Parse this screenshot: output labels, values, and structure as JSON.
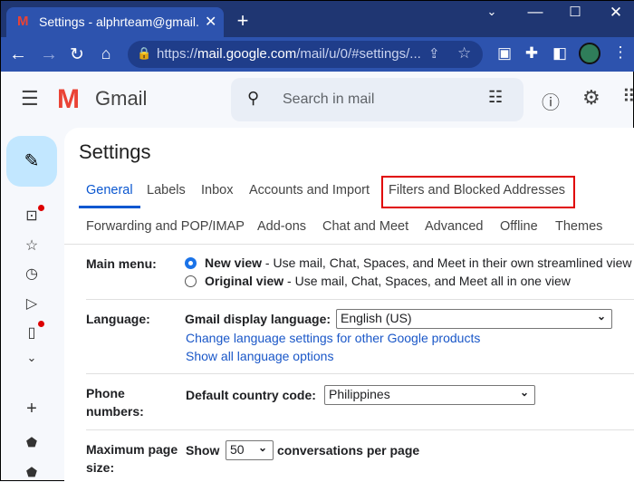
{
  "browser": {
    "tab_title": "Settings - alphrteam@gmail.com",
    "url_prefix": "https://",
    "url_host": "mail.google.com",
    "url_path": "/mail/u/0/#settings/..."
  },
  "app": {
    "name": "Gmail",
    "search_placeholder": "Search in mail"
  },
  "settings": {
    "title": "Settings",
    "tabs_row1": [
      "General",
      "Labels",
      "Inbox",
      "Accounts and Import",
      "Filters and Blocked Addresses"
    ],
    "tabs_row2": [
      "Forwarding and POP/IMAP",
      "Add-ons",
      "Chat and Meet",
      "Advanced",
      "Offline",
      "Themes"
    ],
    "active_tab": "General",
    "highlight_color": "#e00000",
    "main_menu": {
      "label": "Main menu:",
      "new_view": "New view",
      "new_view_desc": " - Use mail, Chat, Spaces, and Meet in their own streamlined view",
      "original_view": "Original view",
      "original_view_desc": " - Use mail, Chat, Spaces, and Meet all in one view"
    },
    "language": {
      "label": "Language:",
      "field_label": "Gmail display language:",
      "value": "English (US)",
      "link1": "Change language settings for other Google products",
      "link2": "Show all language options"
    },
    "phone": {
      "label1": "Phone",
      "label2": "numbers:",
      "field_label": "Default country code:",
      "value": "Philippines"
    },
    "page_size": {
      "label1": "Maximum page",
      "label2": "size:",
      "prefix": "Show",
      "value": "50",
      "suffix": "conversations per page"
    }
  }
}
